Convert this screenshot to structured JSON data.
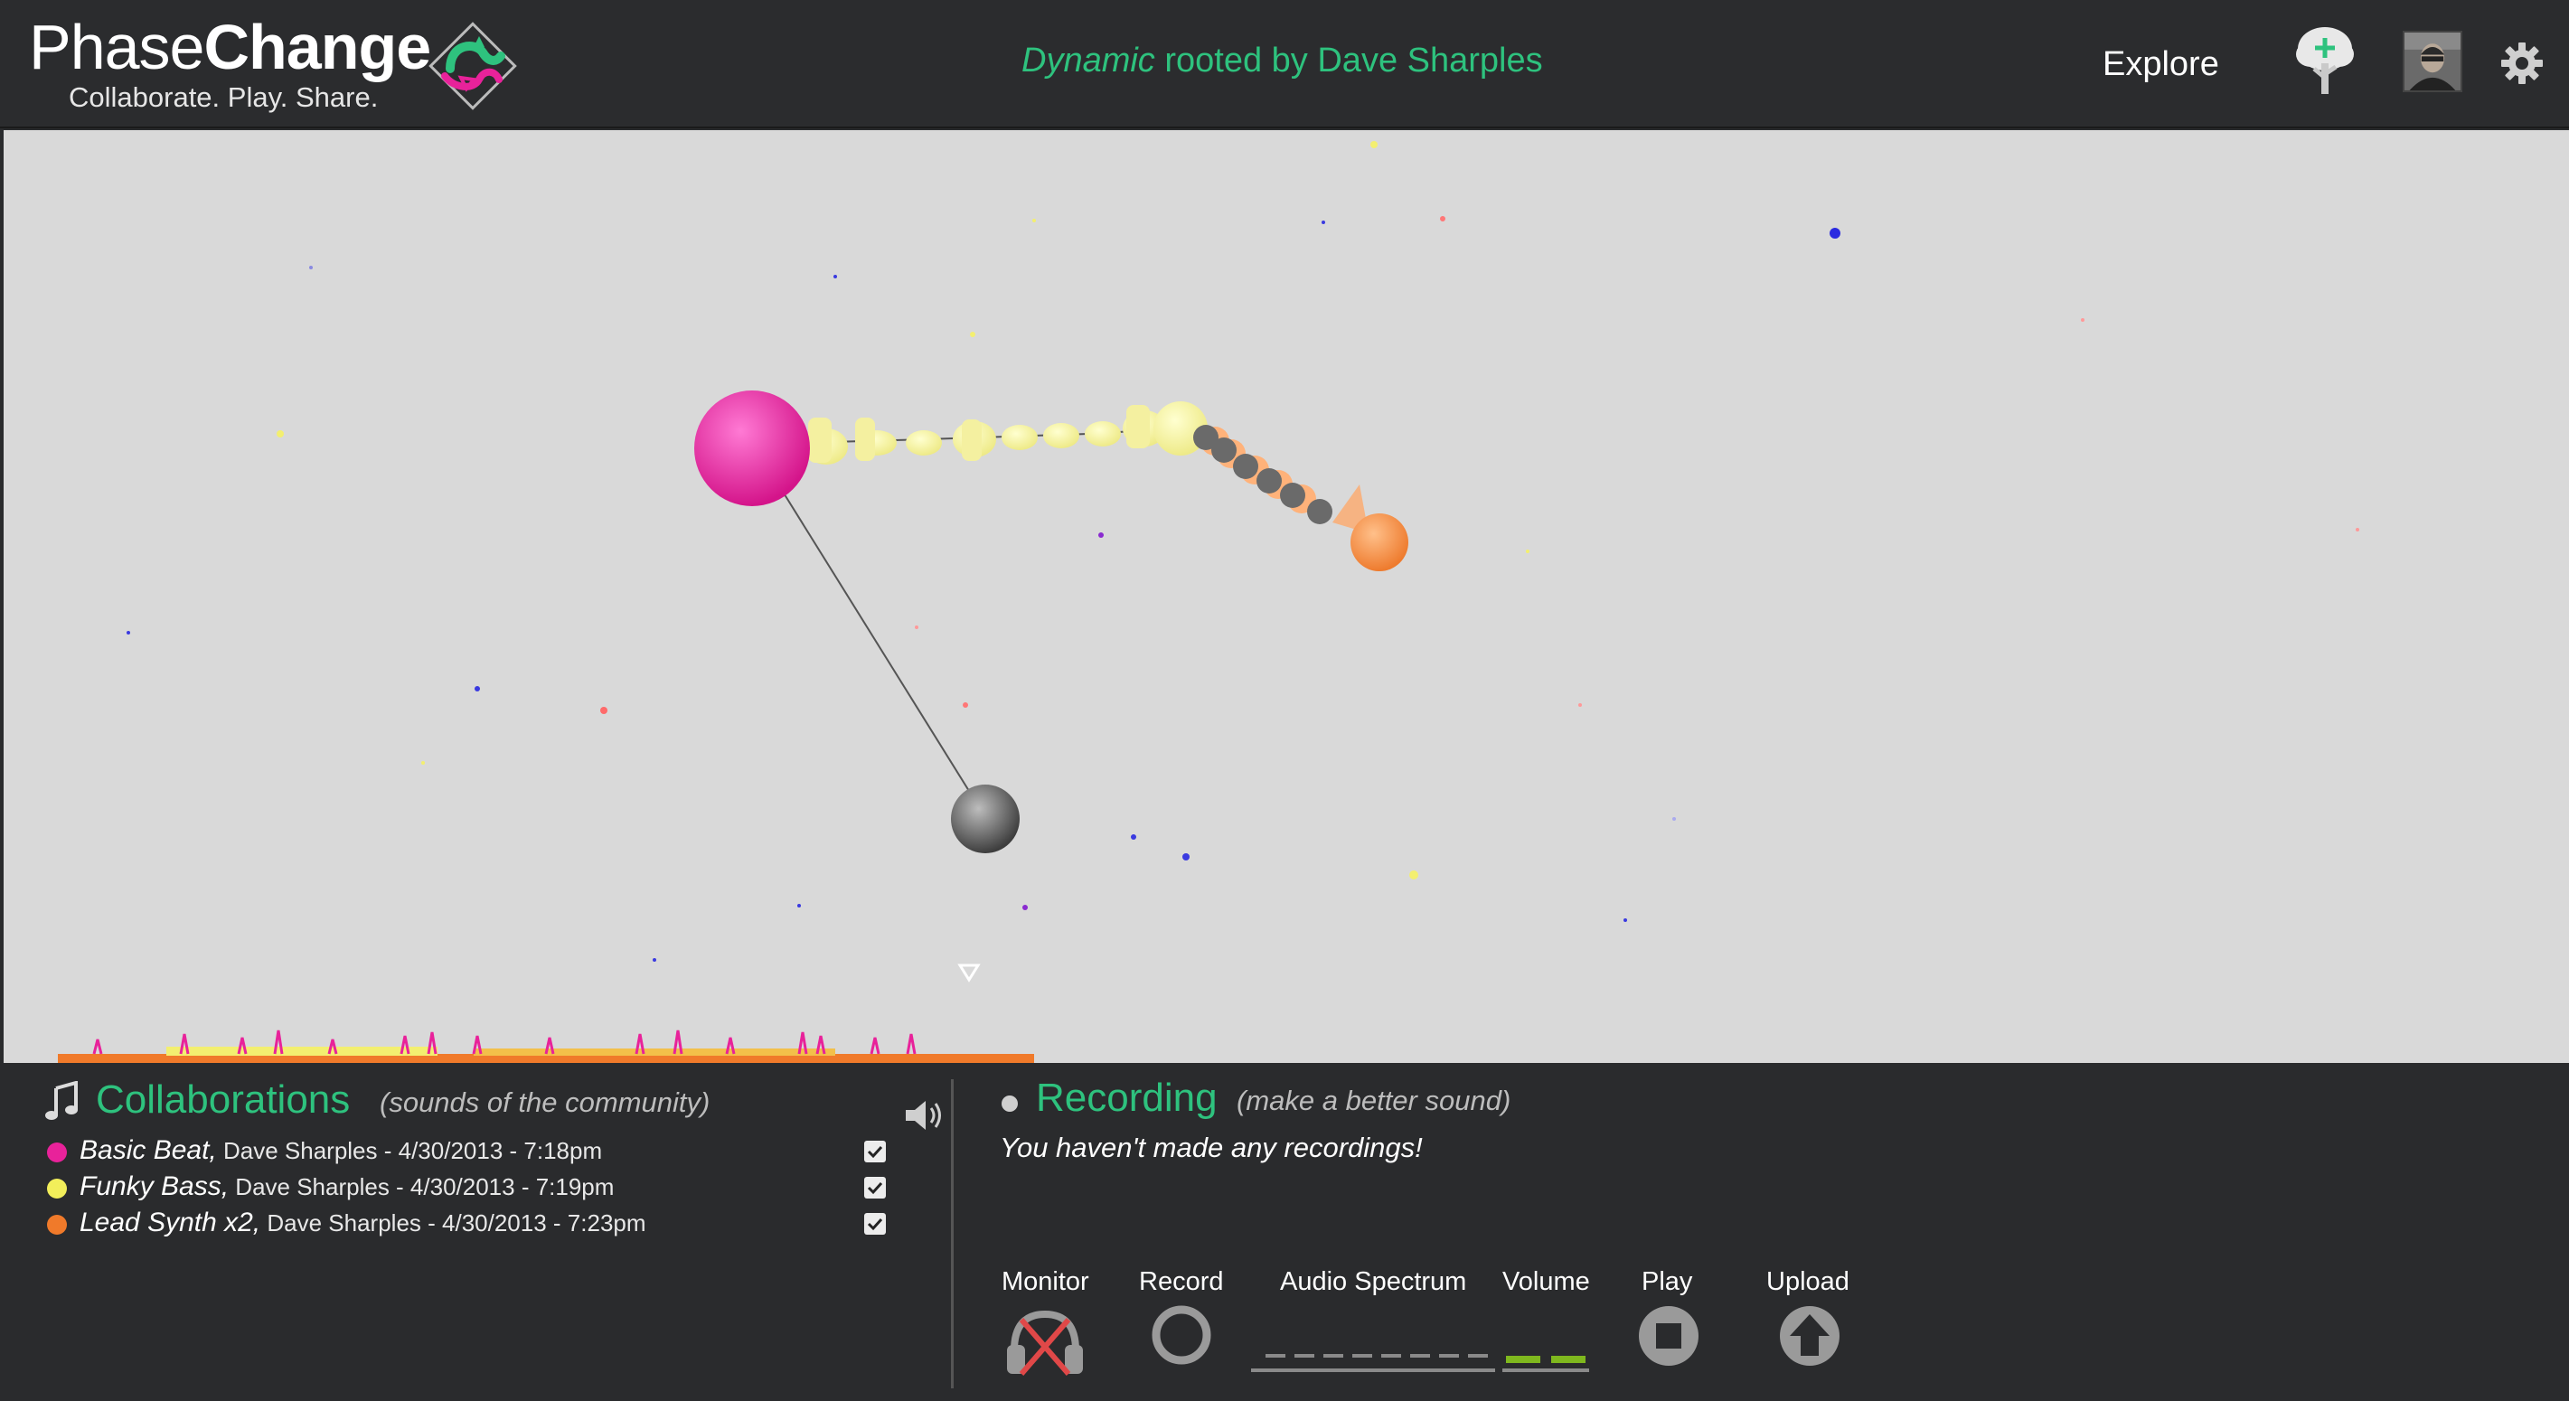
{
  "header": {
    "logo_light": "Phase",
    "logo_bold": "Change",
    "tagline": "Collaborate. Play. Share.",
    "tree_name_em": "Dynamic",
    "tree_rooted": " rooted by Dave Sharples",
    "explore_label": "Explore",
    "icons": {
      "tree": "add-tree-icon",
      "avatar": "user-avatar",
      "settings": "gear-icon"
    },
    "accent_color": "#2ec27e"
  },
  "collaborations": {
    "title": "Collaborations",
    "subtitle": "(sounds of the community)",
    "items": [
      {
        "name": "Basic Beat,",
        "meta": " Dave Sharples - 4/30/2013 - 7:18pm",
        "color": "#e8229a",
        "checked": true
      },
      {
        "name": "Funky Bass,",
        "meta": " Dave Sharples - 4/30/2013 - 7:19pm",
        "color": "#f2ee5a",
        "checked": true
      },
      {
        "name": "Lead Synth x2,",
        "meta": " Dave Sharples - 4/30/2013 - 7:23pm",
        "color": "#f07a2a",
        "checked": true
      }
    ]
  },
  "recording": {
    "title": "Recording",
    "subtitle": "(make a better sound)",
    "empty_message": "You haven't made any recordings!",
    "controls": {
      "monitor": "Monitor",
      "record": "Record",
      "spectrum": "Audio Spectrum",
      "volume": "Volume",
      "play": "Play",
      "upload": "Upload"
    }
  }
}
